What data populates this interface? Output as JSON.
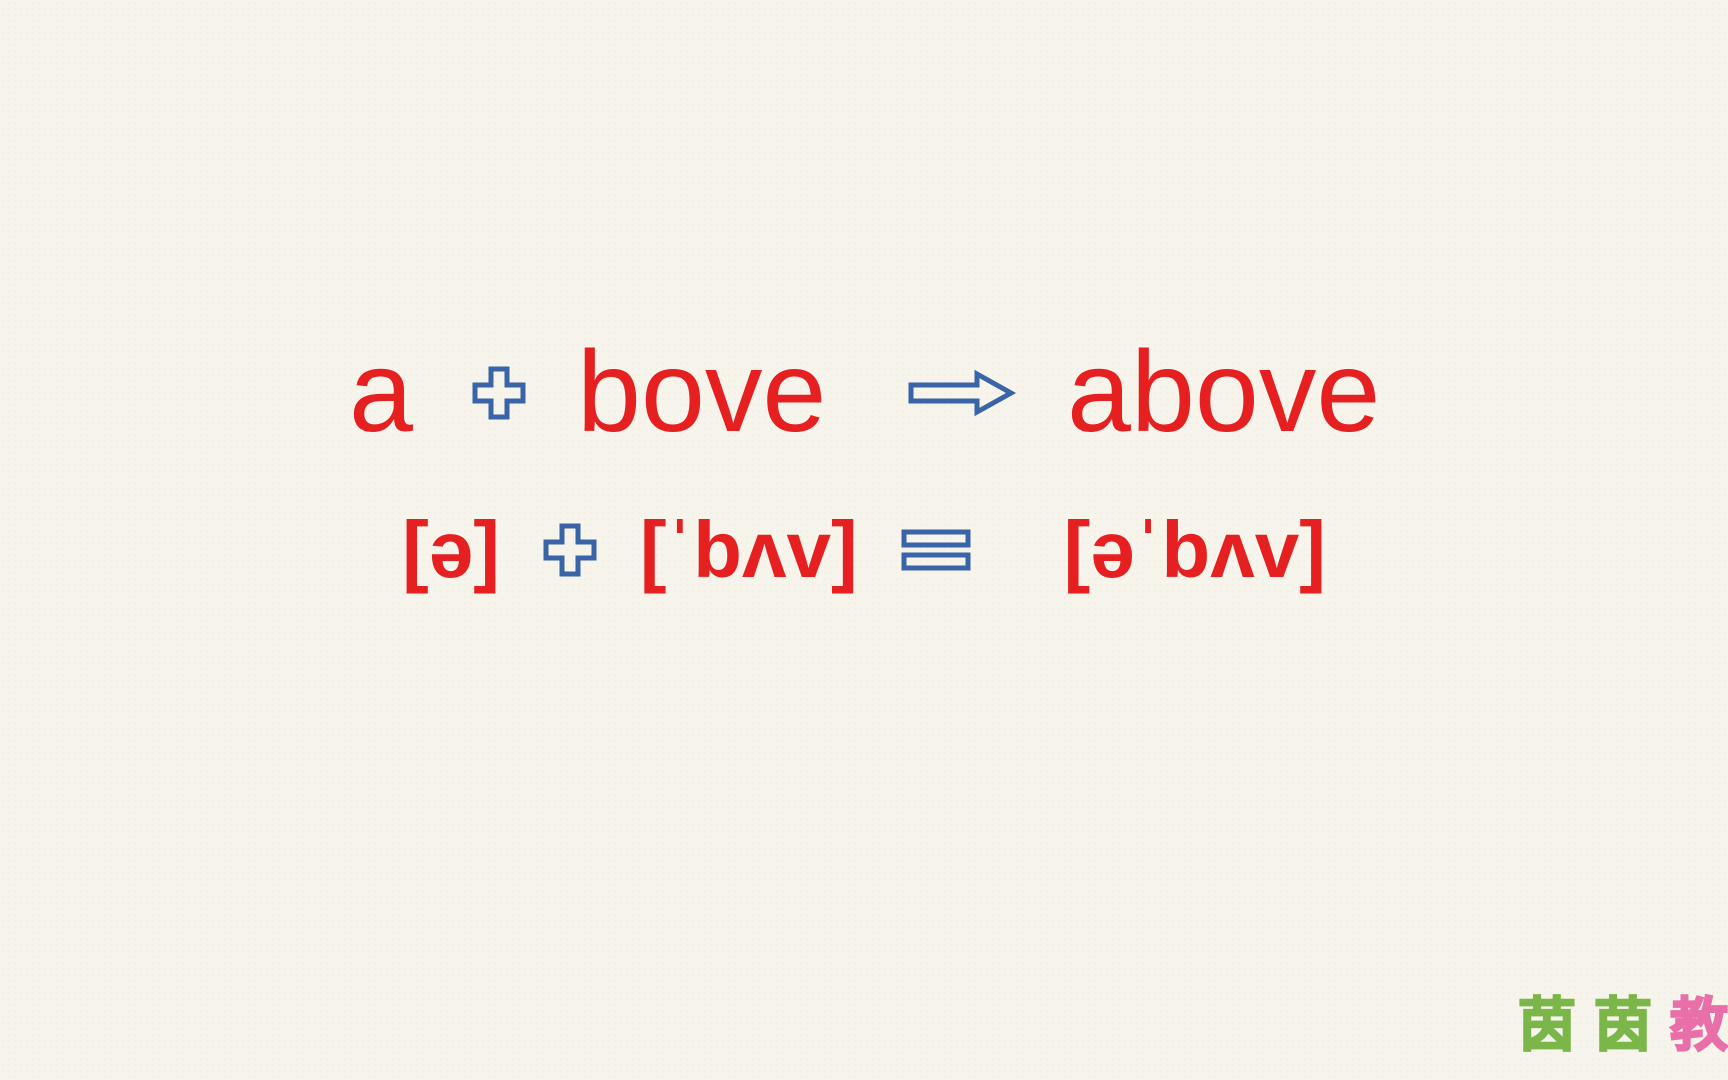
{
  "row1": {
    "part1": "a",
    "part2": "bove",
    "result": "above"
  },
  "row2": {
    "part1": "[ə]",
    "part2": "[ˈbʌv]",
    "result": "[əˈbʌv]"
  },
  "watermark": {
    "c1": "茵",
    "c2": "茵",
    "c3": "教"
  },
  "colors": {
    "text": "#e62020",
    "icon": "#3a64a8",
    "wm_green": "#7ab648",
    "wm_pink": "#e86fa8"
  }
}
